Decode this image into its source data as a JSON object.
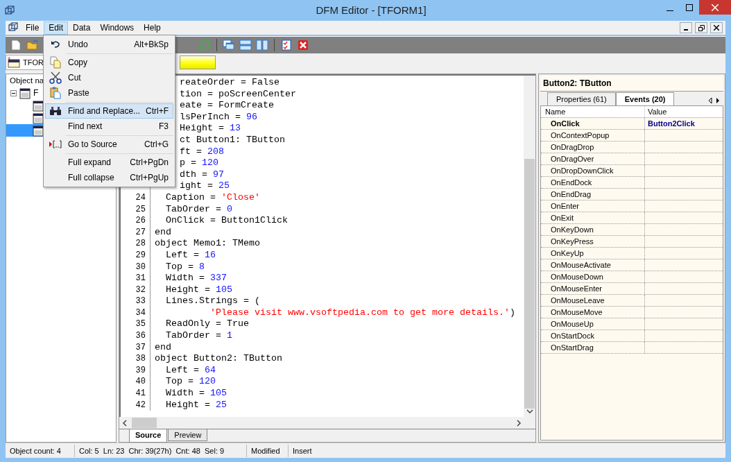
{
  "window": {
    "title": "DFM Editor - [TFORM1]"
  },
  "menu_bar": [
    {
      "label": "File",
      "selected": false
    },
    {
      "label": "Edit",
      "selected": true
    },
    {
      "label": "Data",
      "selected": false
    },
    {
      "label": "Windows",
      "selected": false
    },
    {
      "label": "Help",
      "selected": false
    }
  ],
  "edit_menu": [
    {
      "kind": "item",
      "label": "Undo",
      "shortcut": "Alt+BkSp",
      "selected": false
    },
    {
      "kind": "separator"
    },
    {
      "kind": "item",
      "label": "Copy",
      "selected": false
    },
    {
      "kind": "item",
      "label": "Cut",
      "selected": false
    },
    {
      "kind": "item",
      "label": "Paste",
      "selected": false
    },
    {
      "kind": "separator"
    },
    {
      "kind": "item",
      "label": "Find and Replace...",
      "shortcut": "Ctrl+F",
      "selected": true
    },
    {
      "kind": "item",
      "label": "Find next",
      "shortcut": "F3",
      "selected": false
    },
    {
      "kind": "separator"
    },
    {
      "kind": "item",
      "label": "Go to Source",
      "shortcut": "Ctrl+G",
      "selected": false
    },
    {
      "kind": "separator"
    },
    {
      "kind": "item",
      "label": "Full expand",
      "shortcut": "Ctrl+PgDn",
      "selected": false
    },
    {
      "kind": "item",
      "label": "Full collapse",
      "shortcut": "Ctrl+PgUp",
      "selected": false
    }
  ],
  "form_selector": {
    "value": "TFOR"
  },
  "object_tree": {
    "header": "Object na",
    "items": [
      {
        "label": "F",
        "expanded": true,
        "selected": false,
        "children": [
          {
            "selected": false
          },
          {
            "selected": false
          },
          {
            "selected": true
          }
        ]
      }
    ]
  },
  "source": {
    "lines": [
      {
        "parts": [
          {
            "t": "reateOrder = False"
          }
        ]
      },
      {
        "parts": [
          {
            "t": "tion = poScreenCenter"
          }
        ]
      },
      {
        "parts": [
          {
            "t": "eate = FormCreate"
          }
        ]
      },
      {
        "parts": [
          {
            "t": "lsPerInch = "
          },
          {
            "t": "96",
            "kind": "number"
          }
        ]
      },
      {
        "parts": [
          {
            "t": "Height = "
          },
          {
            "t": "13",
            "kind": "number"
          }
        ]
      },
      {
        "parts": [
          {
            "t": "ct Button1: TButton"
          }
        ]
      },
      {
        "parts": [
          {
            "t": "ft = "
          },
          {
            "t": "208",
            "kind": "number"
          }
        ]
      },
      {
        "parts": [
          {
            "t": "p = "
          },
          {
            "t": "120",
            "kind": "number"
          }
        ]
      },
      {
        "parts": [
          {
            "t": "dth = "
          },
          {
            "t": "97",
            "kind": "number"
          }
        ]
      },
      {
        "parts": [
          {
            "t": "ight = "
          },
          {
            "t": "25",
            "kind": "number"
          }
        ]
      },
      {
        "num": "24",
        "parts": [
          {
            "t": "  Caption = "
          },
          {
            "t": "'Close'",
            "kind": "string"
          }
        ]
      },
      {
        "num": "25",
        "parts": [
          {
            "t": "  TabOrder = "
          },
          {
            "t": "0",
            "kind": "number"
          }
        ]
      },
      {
        "num": "26",
        "parts": [
          {
            "t": "  OnClick = Button1Click"
          }
        ]
      },
      {
        "num": "27",
        "parts": [
          {
            "t": "end"
          }
        ]
      },
      {
        "num": "28",
        "parts": [
          {
            "t": "object Memo1: TMemo"
          }
        ]
      },
      {
        "num": "29",
        "parts": [
          {
            "t": "  Left = "
          },
          {
            "t": "16",
            "kind": "number"
          }
        ]
      },
      {
        "num": "30",
        "parts": [
          {
            "t": "  Top = "
          },
          {
            "t": "8",
            "kind": "number"
          }
        ]
      },
      {
        "num": "31",
        "parts": [
          {
            "t": "  Width = "
          },
          {
            "t": "337",
            "kind": "number"
          }
        ]
      },
      {
        "num": "32",
        "parts": [
          {
            "t": "  Height = "
          },
          {
            "t": "105",
            "kind": "number"
          }
        ]
      },
      {
        "num": "33",
        "parts": [
          {
            "t": "  Lines.Strings = ("
          }
        ]
      },
      {
        "num": "34",
        "parts": [
          {
            "t": "          'Please visit www.vsoftpedia.com to get more details.'",
            "kind": "string"
          },
          {
            "t": ")"
          }
        ]
      },
      {
        "num": "35",
        "parts": [
          {
            "t": "  ReadOnly = True"
          }
        ]
      },
      {
        "num": "36",
        "parts": [
          {
            "t": "  TabOrder = "
          },
          {
            "t": "1",
            "kind": "number"
          }
        ]
      },
      {
        "num": "37",
        "parts": [
          {
            "t": "end"
          }
        ]
      },
      {
        "num": "38",
        "parts": [
          {
            "t": "object Button2: TButton"
          }
        ]
      },
      {
        "num": "39",
        "parts": [
          {
            "t": "  Left = "
          },
          {
            "t": "64",
            "kind": "number"
          }
        ]
      },
      {
        "num": "40",
        "parts": [
          {
            "t": "  Top = "
          },
          {
            "t": "120",
            "kind": "number"
          }
        ]
      },
      {
        "num": "41",
        "parts": [
          {
            "t": "  Width = "
          },
          {
            "t": "105",
            "kind": "number"
          }
        ]
      },
      {
        "num": "42",
        "parts": [
          {
            "t": "  Height = "
          },
          {
            "t": "25",
            "kind": "number"
          }
        ]
      }
    ],
    "tabs": [
      {
        "label": "Source",
        "selected": true
      },
      {
        "label": "Preview",
        "selected": false
      }
    ]
  },
  "inspector": {
    "title": "Button2: TButton",
    "tabs": [
      {
        "label": "Properties (61)",
        "selected": false
      },
      {
        "label": "Events (20)",
        "selected": true
      }
    ],
    "columns": [
      "Name",
      "Value"
    ],
    "rows": [
      {
        "name": "OnClick",
        "value": "Button2Click"
      },
      {
        "name": "OnContextPopup"
      },
      {
        "name": "OnDragDrop"
      },
      {
        "name": "OnDragOver"
      },
      {
        "name": "OnDropDownClick"
      },
      {
        "name": "OnEndDock"
      },
      {
        "name": "OnEndDrag"
      },
      {
        "name": "OnEnter"
      },
      {
        "name": "OnExit"
      },
      {
        "name": "OnKeyDown"
      },
      {
        "name": "OnKeyPress"
      },
      {
        "name": "OnKeyUp"
      },
      {
        "name": "OnMouseActivate"
      },
      {
        "name": "OnMouseDown"
      },
      {
        "name": "OnMouseEnter"
      },
      {
        "name": "OnMouseLeave"
      },
      {
        "name": "OnMouseMove"
      },
      {
        "name": "OnMouseUp"
      },
      {
        "name": "OnStartDock"
      },
      {
        "name": "OnStartDrag"
      }
    ]
  },
  "status_bar": [
    "Object count: 4",
    "Col: 5  Ln: 23  Chr: 39(27h)  Cnt: 48  Sel: 9",
    "Modified",
    "Insert"
  ]
}
